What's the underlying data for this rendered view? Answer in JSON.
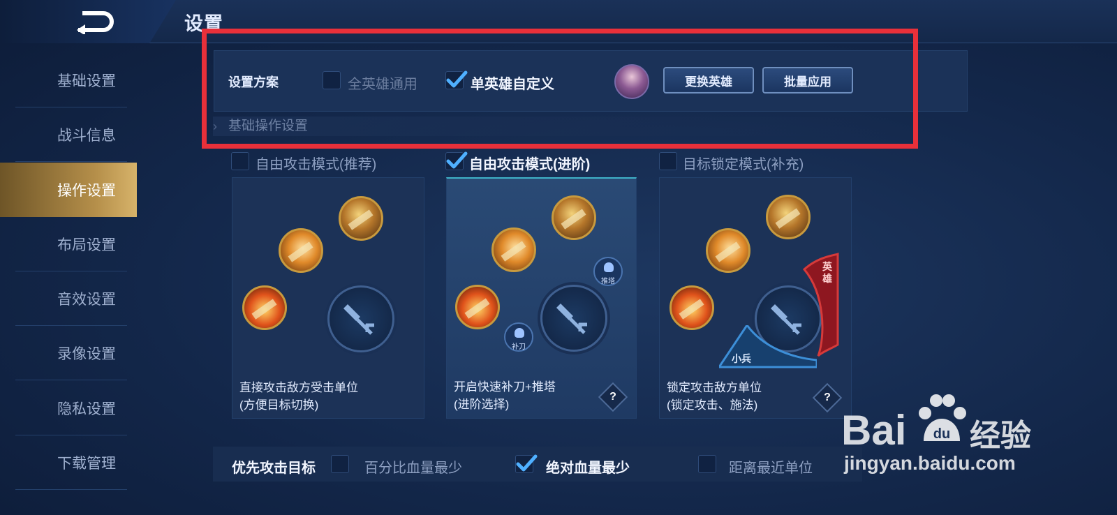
{
  "header": {
    "title": "设置",
    "back_icon": "back-arrow-icon"
  },
  "sidebar": {
    "items": [
      {
        "label": "基础设置",
        "active": false
      },
      {
        "label": "战斗信息",
        "active": false
      },
      {
        "label": "操作设置",
        "active": true
      },
      {
        "label": "布局设置",
        "active": false
      },
      {
        "label": "音效设置",
        "active": false
      },
      {
        "label": "录像设置",
        "active": false
      },
      {
        "label": "隐私设置",
        "active": false
      },
      {
        "label": "下载管理",
        "active": false
      }
    ]
  },
  "scheme": {
    "label": "设置方案",
    "option_all": {
      "label": "全英雄通用",
      "checked": false
    },
    "option_single": {
      "label": "单英雄自定义",
      "checked": true
    },
    "change_hero_button": "更换英雄",
    "batch_apply_button": "批量应用"
  },
  "section": {
    "title": "基础操作设置"
  },
  "modes": [
    {
      "label": "自由攻击模式(推荐)",
      "checked": false,
      "desc_line1": "直接攻击敌方受击单位",
      "desc_line2": "(方便目标切换)",
      "has_help": false
    },
    {
      "label": "自由攻击模式(进阶)",
      "checked": true,
      "desc_line1": "开启快速补刀+推塔",
      "desc_line2": "(进阶选择)",
      "has_help": true,
      "mini_buttons": [
        "推塔",
        "补刀"
      ]
    },
    {
      "label": "目标锁定模式(补充)",
      "checked": false,
      "desc_line1": "锁定攻击敌方单位",
      "desc_line2": "(锁定攻击、施法)",
      "has_help": true,
      "tags": [
        "英雄",
        "小兵"
      ]
    }
  ],
  "help_symbol": "?",
  "priority": {
    "label": "优先攻击目标",
    "options": [
      {
        "label": "百分比血量最少",
        "checked": false
      },
      {
        "label": "绝对血量最少",
        "checked": true
      },
      {
        "label": "距离最近单位",
        "checked": false
      }
    ]
  },
  "watermark": {
    "brand": "Bai",
    "brand_suffix": "经验",
    "url": "jingyan.baidu.com"
  },
  "colors": {
    "accent_gold": "#c89a3e",
    "highlight_frame": "#e8303a",
    "active_tab": "#b58f4a",
    "check_blue": "#4fb0ff"
  }
}
